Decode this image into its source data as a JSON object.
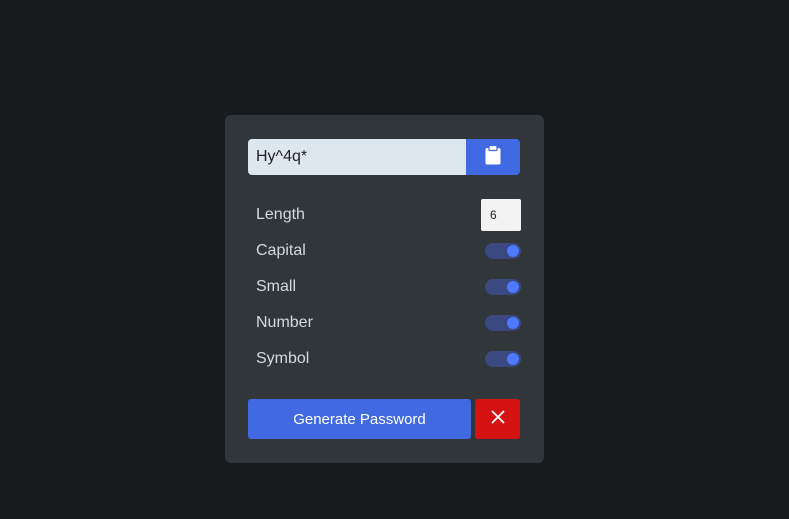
{
  "password": {
    "value": "Hy^4q*",
    "copy_icon": "clipboard-icon"
  },
  "options": {
    "length": {
      "label": "Length",
      "value": "6"
    },
    "items": [
      {
        "label": "Capital",
        "enabled": true
      },
      {
        "label": "Small",
        "enabled": true
      },
      {
        "label": "Number",
        "enabled": true
      },
      {
        "label": "Symbol",
        "enabled": true
      }
    ]
  },
  "actions": {
    "generate_label": "Generate Password",
    "close_icon": "close-icon"
  },
  "colors": {
    "background": "#181b1e",
    "card": "#31363a",
    "accent": "#4169e1",
    "danger": "#d41212",
    "toggle_track": "#3a4a80",
    "toggle_knob": "#4d78ff"
  }
}
